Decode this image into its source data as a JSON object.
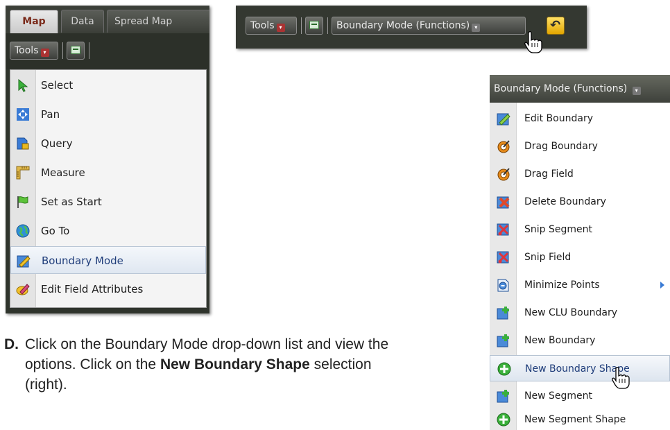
{
  "left_panel": {
    "tabs": [
      {
        "label": "Map",
        "active": true
      },
      {
        "label": "Data",
        "active": false
      },
      {
        "label": "Spread Map",
        "active": false
      }
    ],
    "tools_label": "Tools",
    "tools_menu": [
      {
        "label": "Select",
        "icon": "select-arrow-icon"
      },
      {
        "label": "Pan",
        "icon": "pan-icon"
      },
      {
        "label": "Query",
        "icon": "query-icon"
      },
      {
        "label": "Measure",
        "icon": "measure-icon"
      },
      {
        "label": "Set as Start",
        "icon": "flag-icon"
      },
      {
        "label": "Go To",
        "icon": "globe-icon"
      },
      {
        "label": "Boundary Mode",
        "icon": "boundary-mode-icon",
        "highlighted": true
      },
      {
        "label": "Edit Field Attributes",
        "icon": "edit-attributes-icon"
      }
    ]
  },
  "top_panel": {
    "tools_label": "Tools",
    "mode_dropdown_label": "Boundary Mode (Functions)"
  },
  "right_panel": {
    "header": "Boundary Mode (Functions)",
    "items": [
      {
        "label": "Edit Boundary",
        "icon": "edit-boundary-icon"
      },
      {
        "label": "Drag Boundary",
        "icon": "drag-boundary-icon"
      },
      {
        "label": "Drag Field",
        "icon": "drag-field-icon"
      },
      {
        "label": "Delete Boundary",
        "icon": "delete-boundary-icon"
      },
      {
        "label": "Snip Segment",
        "icon": "snip-segment-icon"
      },
      {
        "label": "Snip Field",
        "icon": "snip-field-icon"
      },
      {
        "label": "Minimize Points",
        "icon": "minimize-points-icon",
        "has_submenu": true
      },
      {
        "label": "New CLU Boundary",
        "icon": "new-clu-boundary-icon"
      },
      {
        "label": "New Boundary",
        "icon": "new-boundary-icon"
      },
      {
        "label": "New Boundary Shape",
        "icon": "new-boundary-shape-icon",
        "highlighted": true
      },
      {
        "label": "New Segment",
        "icon": "new-segment-icon"
      },
      {
        "label": "New Segment Shape",
        "icon": "new-segment-shape-icon"
      }
    ]
  },
  "caption": {
    "letter": "D.",
    "text_before": "Click on the Boundary Mode drop-down list and view the options.  Click on the ",
    "bold": "New Boundary Shape",
    "text_after": " selection (right)."
  },
  "colors": {
    "toolbar_dark": "#343831",
    "menu_bg": "#f4f4f4",
    "highlight_border": "#b9c6d6",
    "highlight_text": "#1f3d7a",
    "undo_yellow": "#ffd22e"
  }
}
